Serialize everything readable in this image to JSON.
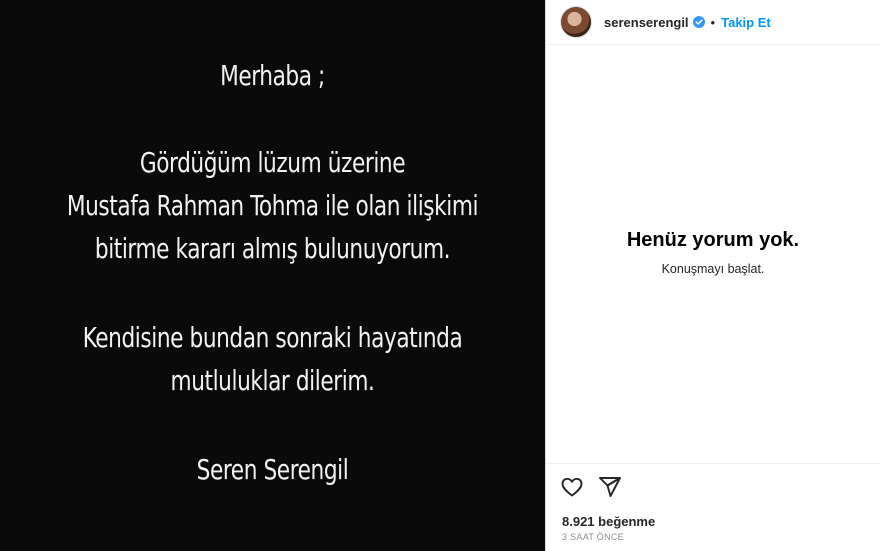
{
  "post": {
    "lines": [
      "Merhaba ;",
      "Gördüğüm lüzum üzerine",
      "Mustafa Rahman Tohma ile olan ilişkimi",
      "bitirme kararı almış bulunuyorum.",
      "Kendisine bundan sonraki hayatında",
      "mutluluklar dilerim.",
      "Seren Serengil"
    ]
  },
  "header": {
    "username": "serenserengil",
    "separator": "•",
    "follow_label": "Takip Et"
  },
  "comments": {
    "empty_title": "Henüz yorum yok.",
    "empty_subtitle": "Konuşmayı başlat."
  },
  "footer": {
    "likes": "8.921 beğenme",
    "time": "3 SAAT ÖNCE"
  },
  "colors": {
    "accent": "#0095f6",
    "verified": "#3897f0",
    "media_bg": "#0a0a0a"
  },
  "icons": [
    "heart-icon",
    "share-icon",
    "verified-badge-icon"
  ]
}
